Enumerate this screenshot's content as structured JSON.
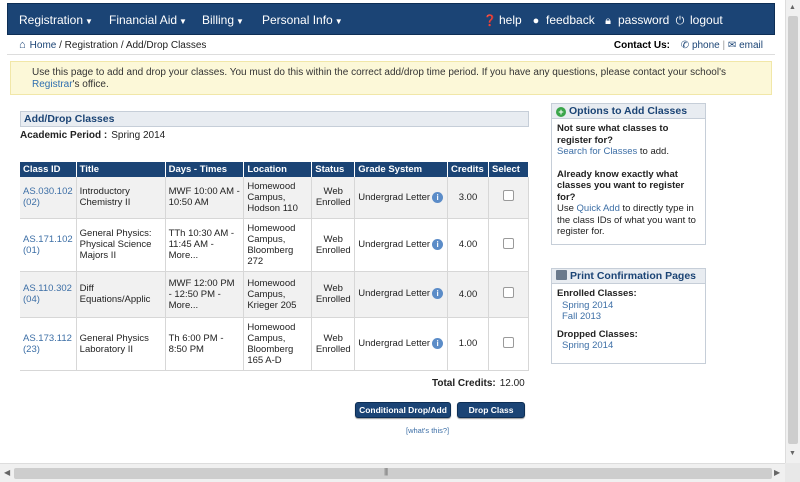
{
  "nav": {
    "menus": [
      {
        "label": "Registration"
      },
      {
        "label": "Financial Aid"
      },
      {
        "label": "Billing"
      },
      {
        "label": "Personal Info"
      }
    ],
    "util": {
      "help": "help",
      "feedback": "feedback",
      "password": "password",
      "logout": "logout"
    }
  },
  "breadcrumb": {
    "home": "Home",
    "rest": " / Registration / Add/Drop Classes"
  },
  "contact": {
    "label": "Contact Us:",
    "phone": "phone",
    "email": "email"
  },
  "notice": {
    "text_before": "Use this page to add and drop your classes. You must do this within the correct add/drop time period. If you have any questions, please contact your school's ",
    "link": "Registrar",
    "text_after": "'s office."
  },
  "main": {
    "title": "Add/Drop Classes",
    "period_label": "Academic Period :",
    "period_value": "Spring 2014",
    "columns": [
      "Class ID",
      "Title",
      "Days - Times",
      "Location",
      "Status",
      "Grade System",
      "Credits",
      "Select"
    ],
    "rows": [
      {
        "id": "AS.030.102 (02)",
        "title": "Introductory Chemistry II",
        "days": "MWF 10:00 AM - 10:50 AM",
        "location": "Homewood Campus, Hodson 110",
        "status": "Web Enrolled",
        "grade": "Undergrad Letter",
        "credits": "3.00"
      },
      {
        "id": "AS.171.102 (01)",
        "title": "General Physics: Physical Science Majors II",
        "days": "TTh 10:30 AM - 11:45 AM - More...",
        "location": "Homewood Campus, Bloomberg 272",
        "status": "Web Enrolled",
        "grade": "Undergrad Letter",
        "credits": "4.00"
      },
      {
        "id": "AS.110.302 (04)",
        "title": "Diff Equations/Applic",
        "days": "MWF 12:00 PM - 12:50 PM - More...",
        "location": "Homewood Campus, Krieger 205",
        "status": "Web Enrolled",
        "grade": "Undergrad Letter",
        "credits": "4.00"
      },
      {
        "id": "AS.173.112 (23)",
        "title": "General Physics Laboratory II",
        "days": "Th 6:00 PM - 8:50 PM",
        "location": "Homewood Campus, Bloomberg 165 A-D",
        "status": "Web Enrolled",
        "grade": "Undergrad Letter",
        "credits": "1.00"
      }
    ],
    "total_label": "Total Credits:",
    "total_value": "12.00",
    "btn_conditional": "Conditional Drop/Add",
    "btn_drop": "Drop Class",
    "whats_this": "[what's this?]"
  },
  "options": {
    "title": "Options to Add Classes",
    "q1": "Not sure what classes to register for?",
    "q1_link": "Search for Classes",
    "q1_after": " to add.",
    "q2": "Already know exactly what classes you want to register for?",
    "q2_before": "Use ",
    "q2_link": "Quick Add",
    "q2_after": " to directly type in the class IDs of what you want to register for."
  },
  "print": {
    "title": "Print Confirmation Pages",
    "enrolled_label": "Enrolled Classes:",
    "enrolled": [
      "Spring 2014",
      "Fall 2013"
    ],
    "dropped_label": "Dropped Classes:",
    "dropped": [
      "Spring 2014"
    ]
  },
  "colors": {
    "nav": "#1b4475",
    "link": "#3d6fa6",
    "notice_bg": "#fcf8d8"
  }
}
